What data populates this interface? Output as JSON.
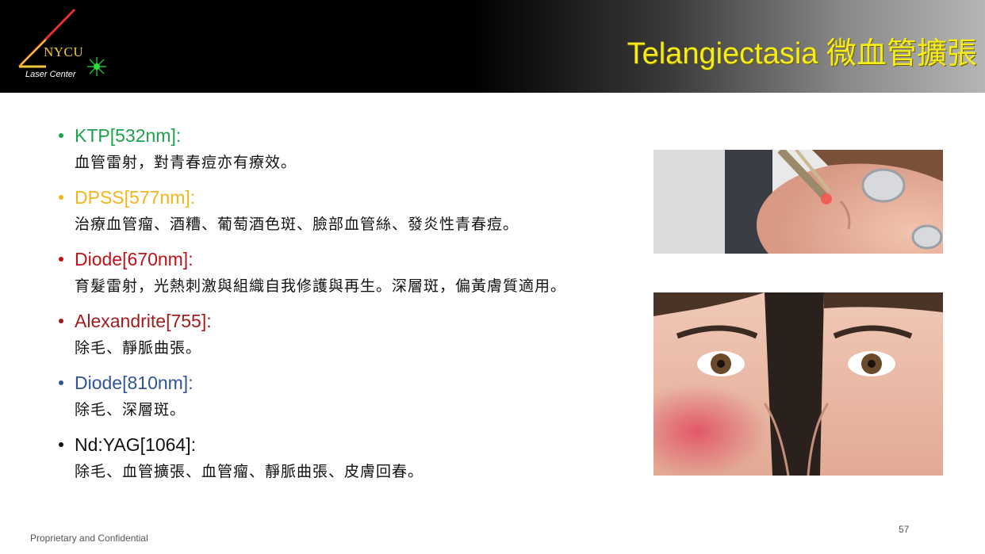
{
  "header": {
    "logo_text": "NYCU",
    "logo_subtitle": "Laser Center",
    "title": "Telangiectasia 微血管擴張"
  },
  "lasers": [
    {
      "name": "KTP[532nm]:",
      "color": "#1aa34a",
      "description": "血管雷射，對青春痘亦有療效。"
    },
    {
      "name": "DPSS[577nm]:",
      "color": "#f2b61c",
      "description": "治療血管瘤、酒糟、葡萄酒色斑、臉部血管絲、發炎性青春痘。"
    },
    {
      "name": "Diode[670nm]:",
      "color": "#c1121a",
      "description": "育髮雷射，光熱刺激與組織自我修護與再生。深層斑，偏黃膚質適用。"
    },
    {
      "name": "Alexandrite[755]:",
      "color": "#9e1b1b",
      "description": "除毛、靜脈曲張。"
    },
    {
      "name": "Diode[810nm]:",
      "color": "#2f5597",
      "description": "除毛、深層斑。"
    },
    {
      "name": "Nd:YAG[1064]:",
      "color": "#111111",
      "description": "除毛、血管擴張、血管瘤、靜脈曲張、皮膚回春。"
    }
  ],
  "images": [
    {
      "icon": "laser-treatment-photo"
    },
    {
      "icon": "face-before-after-photo"
    }
  ],
  "footer": {
    "confidential": "Proprietary and Confidential",
    "page_number": "57"
  }
}
